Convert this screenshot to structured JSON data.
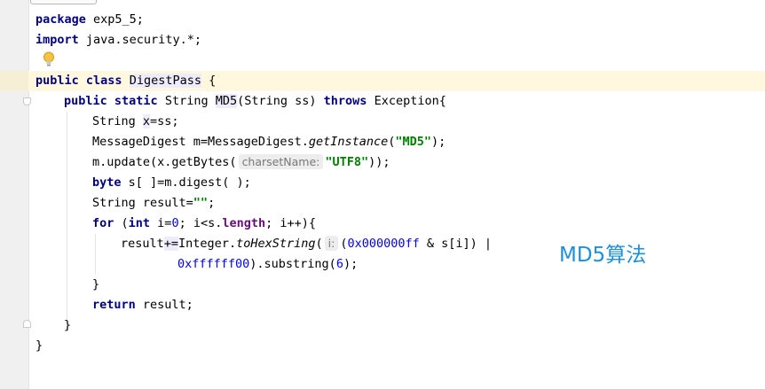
{
  "editor": {
    "lines": {
      "l1": {
        "package_kw": "package",
        "package_name": " exp5_5;"
      },
      "l2": {
        "import_kw": "import",
        "import_name": " java.security.*;"
      },
      "l4": {
        "public_kw": "public",
        "class_kw": "class",
        "class_name": "DigestPass",
        "brace": " {"
      },
      "l5": {
        "public_kw": "public",
        "static_kw": "static",
        "ret_type": " String ",
        "method": "MD5",
        "params": "(String ss) ",
        "throws_kw": "throws",
        "exc": " Exception{"
      },
      "l6": {
        "pre": "String ",
        "var": "x",
        "post": "=ss;"
      },
      "l7": {
        "pre": "MessageDigest m=MessageDigest.",
        "method": "getInstance",
        "open": "(",
        "arg": "\"MD5\"",
        "close": ");"
      },
      "l8": {
        "pre": "m.update(x.getBytes(",
        "hint": "charsetName:",
        "arg": "\"UTF8\"",
        "close": "));"
      },
      "l9": {
        "kw": "byte",
        "rest": " s[ ]=m.digest( );"
      },
      "l10": {
        "pre": "String result=",
        "str": "\"\"",
        "post": ";"
      },
      "l11": {
        "for_kw": "for",
        "open": " (",
        "int_kw": "int",
        "mid": " i=",
        "zero": "0",
        "cond": "; i<s.",
        "length": "length",
        "tail": "; i++){"
      },
      "l12": {
        "pre": "result",
        "op": "+=",
        "cls": "Integer.",
        "method": "toHexString",
        "open": "(",
        "hint": "i:",
        "paren": "(",
        "hex": "0x000000ff",
        "tail": " & s[i]) |"
      },
      "l13": {
        "hex": "0xffffff00",
        "tail": ").substring(",
        "six": "6",
        "end": ");"
      },
      "l14": {
        "text": "}"
      },
      "l15": {
        "kw": "return",
        "rest": " result;"
      },
      "l16": {
        "text": "}"
      },
      "l17": {
        "text": "}"
      }
    }
  },
  "overlay": {
    "label": "MD5算法"
  },
  "colors": {
    "keyword": "#000080",
    "string": "#008000",
    "number": "#0000ff",
    "field": "#660e7a",
    "caret_line": "#fff8df",
    "annotation": "#1e8fdc"
  }
}
